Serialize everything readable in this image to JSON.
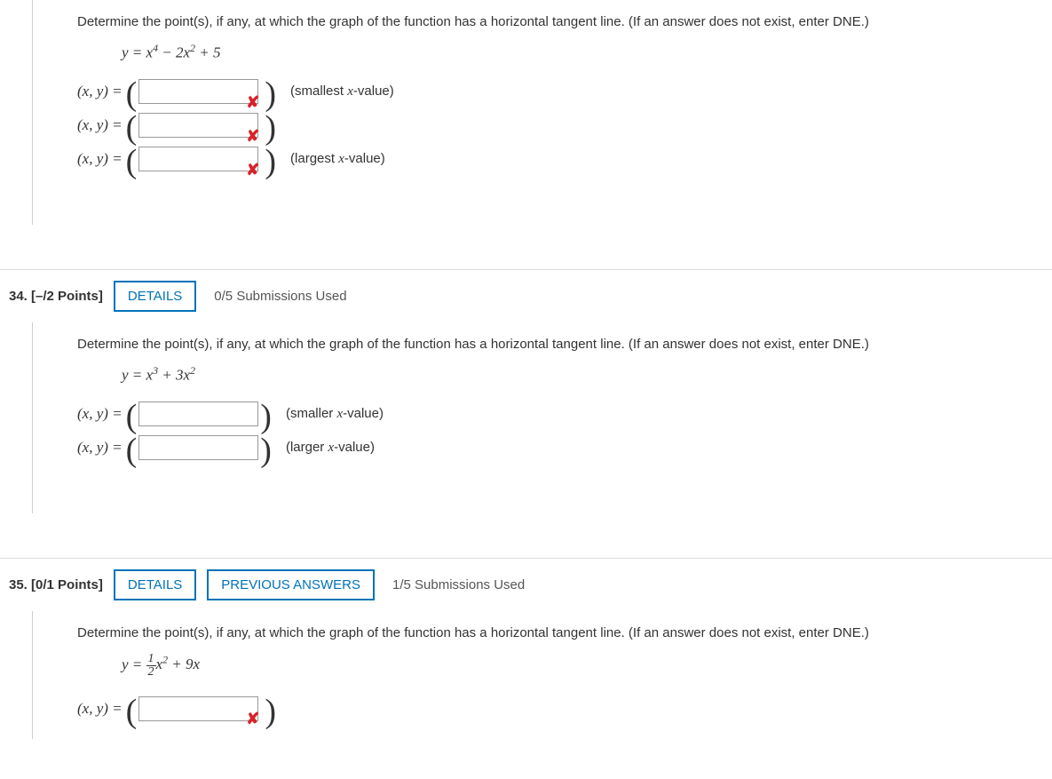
{
  "q33": {
    "prompt": "Determine the point(s), if any, at which the graph of the function has a horizontal tangent line. (If an answer does not exist, enter DNE.)",
    "equation_html": "y = x<sup>4</sup> − 2x<sup>2</sup> + 5",
    "rows": [
      {
        "lhs": "(x, y) = ",
        "wrong": true,
        "hint_pre": "(smallest ",
        "hint_var": "x",
        "hint_post": "-value)"
      },
      {
        "lhs": "(x, y) = ",
        "wrong": true,
        "hint_pre": "",
        "hint_var": "",
        "hint_post": ""
      },
      {
        "lhs": "(x, y) = ",
        "wrong": true,
        "hint_pre": "(largest ",
        "hint_var": "x",
        "hint_post": "-value)"
      }
    ]
  },
  "q34": {
    "number": "34.",
    "points": "[–/2 Points]",
    "details": "DETAILS",
    "submissions": "0/5 Submissions Used",
    "prompt": "Determine the point(s), if any, at which the graph of the function has a horizontal tangent line. (If an answer does not exist, enter DNE.)",
    "equation_html": "y = x<sup>3</sup> + 3x<sup>2</sup>",
    "rows": [
      {
        "lhs": "(x, y) = ",
        "wrong": false,
        "hint_pre": "(smaller ",
        "hint_var": "x",
        "hint_post": "-value)"
      },
      {
        "lhs": "(x, y) = ",
        "wrong": false,
        "hint_pre": "(larger ",
        "hint_var": "x",
        "hint_post": "-value)"
      }
    ]
  },
  "q35": {
    "number": "35.",
    "points": "[0/1 Points]",
    "details": "DETAILS",
    "prev": "PREVIOUS ANSWERS",
    "submissions": "1/5 Submissions Used",
    "prompt": "Determine the point(s), if any, at which the graph of the function has a horizontal tangent line. (If an answer does not exist, enter DNE.)",
    "eq_y": "y = ",
    "eq_num": "1",
    "eq_den": "2",
    "eq_rest_html": "x<sup>2</sup> + 9x",
    "rows": [
      {
        "lhs": "(x, y) = ",
        "wrong": true,
        "hint_pre": "",
        "hint_var": "",
        "hint_post": ""
      }
    ]
  }
}
